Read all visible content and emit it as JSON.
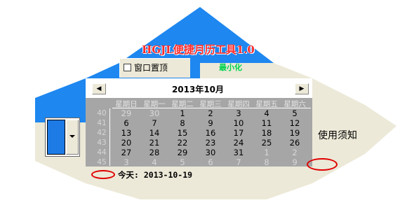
{
  "app": {
    "title": "HGJL便捷月历工具1.0",
    "topmost_label": "窗口置顶",
    "minimize_label": "最小化",
    "help_label": "使用须知"
  },
  "colors": {
    "accent_blue": "#1e87f0",
    "panel_beige": "#ece9d8",
    "title_red": "#ff2a2a",
    "minimize_green": "#00d24a",
    "today_circle": "#e00000"
  },
  "calendar": {
    "prev_icon": "left-arrow-icon",
    "next_icon": "right-arrow-icon",
    "month_title": "2013年10月",
    "weekdays": [
      "星期日",
      "星期一",
      "星期二",
      "星期三",
      "星期四",
      "星期五",
      "星期六"
    ],
    "week_numbers": [
      "40",
      "41",
      "42",
      "43",
      "44",
      "45"
    ],
    "weeks": [
      [
        {
          "d": "29",
          "dim": true
        },
        {
          "d": "30",
          "dim": true
        },
        {
          "d": "1"
        },
        {
          "d": "2"
        },
        {
          "d": "3"
        },
        {
          "d": "4"
        },
        {
          "d": "5"
        }
      ],
      [
        {
          "d": "6"
        },
        {
          "d": "7"
        },
        {
          "d": "8"
        },
        {
          "d": "9"
        },
        {
          "d": "10"
        },
        {
          "d": "11"
        },
        {
          "d": "12"
        }
      ],
      [
        {
          "d": "13"
        },
        {
          "d": "14"
        },
        {
          "d": "15"
        },
        {
          "d": "16"
        },
        {
          "d": "17"
        },
        {
          "d": "18"
        },
        {
          "d": "19",
          "today": true
        }
      ],
      [
        {
          "d": "20"
        },
        {
          "d": "21"
        },
        {
          "d": "22"
        },
        {
          "d": "23"
        },
        {
          "d": "24"
        },
        {
          "d": "25"
        },
        {
          "d": "26"
        }
      ],
      [
        {
          "d": "27"
        },
        {
          "d": "28"
        },
        {
          "d": "29"
        },
        {
          "d": "30"
        },
        {
          "d": "31"
        },
        {
          "d": "1",
          "dim": true
        },
        {
          "d": "2",
          "dim": true
        }
      ],
      [
        {
          "d": "3",
          "dim": true
        },
        {
          "d": "4",
          "dim": true
        },
        {
          "d": "5",
          "dim": true
        },
        {
          "d": "6",
          "dim": true
        },
        {
          "d": "7",
          "dim": true
        },
        {
          "d": "8",
          "dim": true
        },
        {
          "d": "9",
          "dim": true
        }
      ]
    ],
    "today_text": "今天: 2013-10-19"
  }
}
